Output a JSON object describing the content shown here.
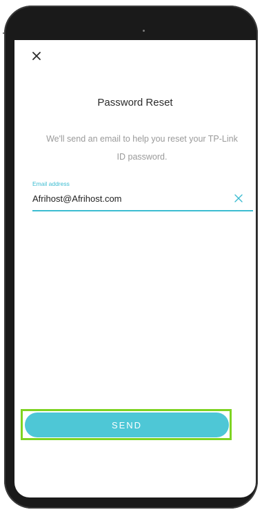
{
  "header": {
    "close_icon": "close-icon"
  },
  "content": {
    "title": "Password Reset",
    "description": "We'll send an email to help you reset your TP-Link ID password."
  },
  "email_field": {
    "label": "Email address",
    "value": "Afrihost@Afrihost.com",
    "clear_icon": "clear-icon"
  },
  "actions": {
    "send_label": "SEND"
  },
  "colors": {
    "accent": "#3bbcd1",
    "button": "#4ec7d6",
    "highlight": "#7ed321"
  }
}
